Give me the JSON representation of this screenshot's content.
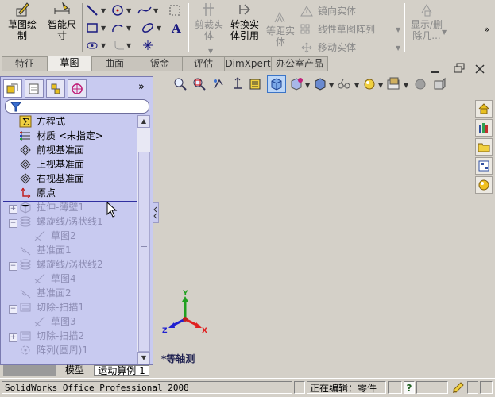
{
  "toolbar": {
    "sketch_label": "草图绘\n制",
    "smart_dim_label": "智能尺\n寸",
    "trim_label": "剪裁实\n体",
    "convert_label": "转换实\n体引用",
    "offset_label": "等距实\n体",
    "mirror_label": "镜向实体",
    "linear_pattern_label": "线性草图阵列",
    "move_label": "移动实体",
    "show_delete_label": "显示/删\n除几...",
    "more_icon": "chevron-right"
  },
  "tabs": [
    "特征",
    "草图",
    "曲面",
    "钣金",
    "评估",
    "DimXpert",
    "办公室产品"
  ],
  "active_tab": "草图",
  "tree": {
    "items": [
      {
        "label": "方程式",
        "icon": "equation-icon",
        "dim": false
      },
      {
        "label": "材质 <未指定>",
        "icon": "material-icon",
        "dim": false
      },
      {
        "label": "前视基准面",
        "icon": "plane-icon",
        "dim": false
      },
      {
        "label": "上视基准面",
        "icon": "plane-icon",
        "dim": false
      },
      {
        "label": "右视基准面",
        "icon": "plane-icon",
        "dim": false
      },
      {
        "label": "原点",
        "icon": "origin-icon",
        "dim": false
      },
      {
        "label": "拉伸-薄壁1",
        "icon": "extrude-icon",
        "dim": true
      },
      {
        "label": "螺旋线/涡状线1",
        "icon": "helix-icon",
        "dim": true
      },
      {
        "label": "草图2",
        "icon": "sketch-icon",
        "dim": true
      },
      {
        "label": "基准面1",
        "icon": "plane-icon",
        "dim": true
      },
      {
        "label": "螺旋线/涡状线2",
        "icon": "helix-icon",
        "dim": true
      },
      {
        "label": "草图4",
        "icon": "sketch-icon",
        "dim": true
      },
      {
        "label": "基准面2",
        "icon": "plane-icon",
        "dim": true
      },
      {
        "label": "切除-扫描1",
        "icon": "sweep-cut-icon",
        "dim": true
      },
      {
        "label": "草图3",
        "icon": "sketch-icon",
        "dim": true
      },
      {
        "label": "切除-扫描2",
        "icon": "sweep-cut-icon",
        "dim": true
      },
      {
        "label": "阵列(圆周)1",
        "icon": "circular-pattern-icon",
        "dim": true
      }
    ]
  },
  "bottom_tabs": [
    "模型",
    "运动算例 1"
  ],
  "view": {
    "name": "*等轴测",
    "triad": {
      "x": "X",
      "y": "Y",
      "z": "Z"
    }
  },
  "status": {
    "app": "SolidWorks Office Professional 2008",
    "editing": "正在编辑：零件",
    "help": "?"
  },
  "colors": {
    "panel_bg": "#c8caf0",
    "accent": "#3030a0",
    "x_axis": "#e02020",
    "y_axis": "#20a020",
    "z_axis": "#2020d0"
  }
}
